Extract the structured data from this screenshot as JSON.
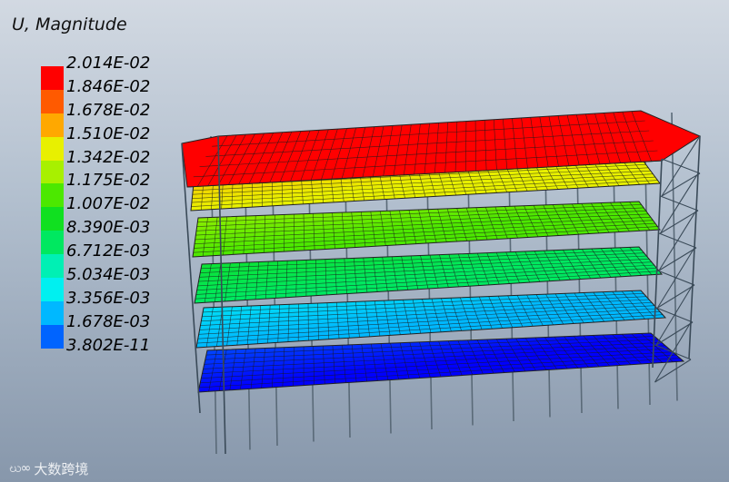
{
  "viewer": {
    "title": "U, Magnitude"
  },
  "legend": {
    "labels": [
      "2.014E-02",
      "1.846E-02",
      "1.678E-02",
      "1.510E-02",
      "1.342E-02",
      "1.175E-02",
      "1.007E-02",
      "8.390E-03",
      "6.712E-03",
      "5.034E-03",
      "3.356E-03",
      "1.678E-03",
      "3.802E-11"
    ],
    "colors": [
      "#ff0000",
      "#ff5a00",
      "#ffa800",
      "#e8f000",
      "#a8f000",
      "#4ce800",
      "#10e020",
      "#00e860",
      "#00f0b4",
      "#00f0f0",
      "#00b8ff",
      "#0064ff",
      "#0000ff"
    ]
  },
  "watermark": {
    "logo": "ဃ∞",
    "text": "大数跨境"
  }
}
